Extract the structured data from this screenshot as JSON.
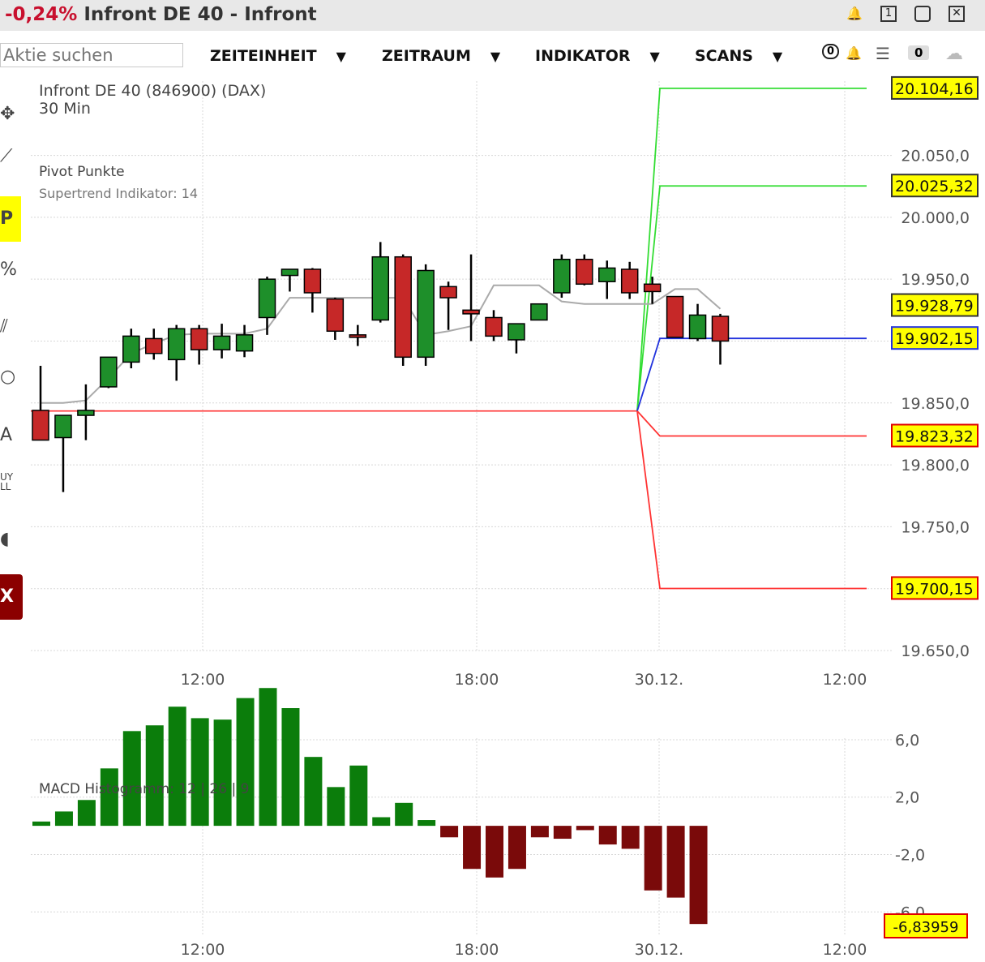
{
  "window": {
    "change": "-0,24%",
    "title": "Infront DE 40 - Infront"
  },
  "toolbar": {
    "search_placeholder": "Aktie suchen",
    "menus": [
      "ZEITEINHEIT",
      "ZEITRAUM",
      "INDIKATOR",
      "SCANS"
    ],
    "alert_count": "0",
    "watch_count": "0"
  },
  "left_tools": [
    "P",
    "%",
    "A",
    "UY",
    "LL",
    "X"
  ],
  "colors": {
    "up": "#1e8f2a",
    "down": "#c62828",
    "macd_pos": "#0b7d0b",
    "macd_neg": "#7a0a0a",
    "pivot_up": "#33dd33",
    "pivot_down": "#ff3333",
    "pivot_mid": "#2233dd",
    "supertrend": "#aaaaaa",
    "label_bg": "#ffff00"
  },
  "chart_data": [
    {
      "type": "candlestick",
      "title": "Infront DE 40 (846900) (DAX)",
      "subtitle": "30 Min",
      "legend": [
        "Pivot Punkte",
        "Supertrend Indikator: 14"
      ],
      "ylim": [
        19650,
        20110
      ],
      "y_ticks": [
        "20.050,0",
        "20.000,0",
        "19.950,0",
        "19.900,0",
        "19.850,0",
        "19.800,0",
        "19.750,0",
        "19.700,0",
        "19.650,0"
      ],
      "x_ticks": [
        "12:00",
        "18:00",
        "30.12.",
        "12:00"
      ],
      "candles": [
        {
          "o": 19844,
          "h": 19880,
          "l": 19820,
          "c": 19820
        },
        {
          "o": 19822,
          "h": 19840,
          "l": 19778,
          "c": 19840
        },
        {
          "o": 19840,
          "h": 19865,
          "l": 19820,
          "c": 19844
        },
        {
          "o": 19863,
          "h": 19887,
          "l": 19862,
          "c": 19887
        },
        {
          "o": 19883,
          "h": 19910,
          "l": 19878,
          "c": 19904
        },
        {
          "o": 19902,
          "h": 19910,
          "l": 19885,
          "c": 19890
        },
        {
          "o": 19885,
          "h": 19913,
          "l": 19868,
          "c": 19910
        },
        {
          "o": 19910,
          "h": 19913,
          "l": 19881,
          "c": 19893
        },
        {
          "o": 19893,
          "h": 19914,
          "l": 19886,
          "c": 19904
        },
        {
          "o": 19892,
          "h": 19913,
          "l": 19887,
          "c": 19905
        },
        {
          "o": 19919,
          "h": 19952,
          "l": 19905,
          "c": 19950
        },
        {
          "o": 19953,
          "h": 19958,
          "l": 19940,
          "c": 19958
        },
        {
          "o": 19958,
          "h": 19959,
          "l": 19923,
          "c": 19939
        },
        {
          "o": 19934,
          "h": 19935,
          "l": 19901,
          "c": 19908
        },
        {
          "o": 19905,
          "h": 19913,
          "l": 19896,
          "c": 19903
        },
        {
          "o": 19917,
          "h": 19980,
          "l": 19915,
          "c": 19968
        },
        {
          "o": 19968,
          "h": 19970,
          "l": 19880,
          "c": 19887
        },
        {
          "o": 19887,
          "h": 19962,
          "l": 19880,
          "c": 19957
        },
        {
          "o": 19944,
          "h": 19948,
          "l": 19909,
          "c": 19935
        },
        {
          "o": 19925,
          "h": 19970,
          "l": 19900,
          "c": 19922
        },
        {
          "o": 19919,
          "h": 19925,
          "l": 19900,
          "c": 19904
        },
        {
          "o": 19901,
          "h": 19912,
          "l": 19890,
          "c": 19914
        },
        {
          "o": 19917,
          "h": 19930,
          "l": 19922,
          "c": 19930
        },
        {
          "o": 19939,
          "h": 19970,
          "l": 19935,
          "c": 19966
        },
        {
          "o": 19966,
          "h": 19970,
          "l": 19945,
          "c": 19946
        },
        {
          "o": 19948,
          "h": 19965,
          "l": 19934,
          "c": 19959
        },
        {
          "o": 19958,
          "h": 19964,
          "l": 19934,
          "c": 19939
        },
        {
          "o": 19946,
          "h": 19952,
          "l": 19930,
          "c": 19940
        },
        {
          "o": 19936,
          "h": 19936,
          "l": 19906,
          "c": 19903
        },
        {
          "o": 19902,
          "h": 19930,
          "l": 19900,
          "c": 19921
        },
        {
          "o": 19920,
          "h": 19922,
          "l": 19881,
          "c": 19900
        }
      ],
      "supertrend": [
        19850,
        19850,
        19852,
        19870,
        19890,
        19898,
        19905,
        19906,
        19906,
        19906,
        19910,
        19935,
        19935,
        19935,
        19935,
        19935,
        19935,
        19905,
        19908,
        19912,
        19945,
        19945,
        19945,
        19932,
        19930,
        19930,
        19930,
        19930,
        19942,
        19942,
        19926
      ],
      "pivots": [
        {
          "label": "20.104,16",
          "value": 20104.16,
          "color": "up"
        },
        {
          "label": "20.025,32",
          "value": 20025.32,
          "color": "up"
        },
        {
          "label": "19.928,79",
          "value": 19928.79,
          "color": "none"
        },
        {
          "label": "19.902,15",
          "value": 19902.15,
          "color": "mid"
        },
        {
          "label": "19.823,32",
          "value": 19823.32,
          "color": "down"
        },
        {
          "label": "19.700,15",
          "value": 19700.15,
          "color": "down"
        }
      ],
      "previous_pivot": 19843.5
    },
    {
      "type": "bar",
      "title": "MACD Histogramm: 12 | 26 | 9",
      "ylim": [
        -7.0,
        9.5
      ],
      "y_ticks": [
        "6,0",
        "2,0",
        "-2,0",
        "-6,0"
      ],
      "x_ticks": [
        "12:00",
        "18:00",
        "30.12.",
        "12:00"
      ],
      "last_value": "-6,83959",
      "values": [
        0.3,
        1.0,
        1.8,
        4.0,
        6.6,
        7.0,
        8.3,
        7.5,
        7.4,
        8.9,
        9.6,
        8.2,
        4.8,
        2.7,
        4.2,
        0.6,
        1.6,
        0.4,
        -0.8,
        -3.0,
        -3.6,
        -3.0,
        -0.8,
        -0.9,
        -0.3,
        -1.3,
        -1.6,
        -4.5,
        -5.0,
        -6.84
      ]
    }
  ]
}
